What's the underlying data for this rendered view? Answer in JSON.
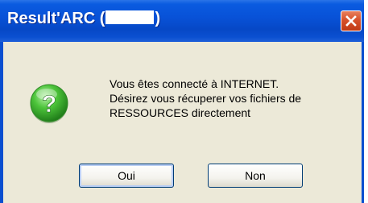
{
  "dialog": {
    "title_prefix": "Result'ARC (",
    "title_suffix": ")",
    "message_lines": [
      "Vous êtes connecté à INTERNET.",
      "Désirez vous récuperer vos fichiers de",
      "RESSOURCES directement"
    ],
    "buttons": {
      "yes_label": "Oui",
      "no_label": "Non"
    },
    "icon": "question-icon",
    "close_icon": "close-icon"
  },
  "colors": {
    "titlebar": "#0a4fd0",
    "window_face": "#ece9d8",
    "close_button": "#d6512b",
    "icon_green": "#3fae35"
  }
}
